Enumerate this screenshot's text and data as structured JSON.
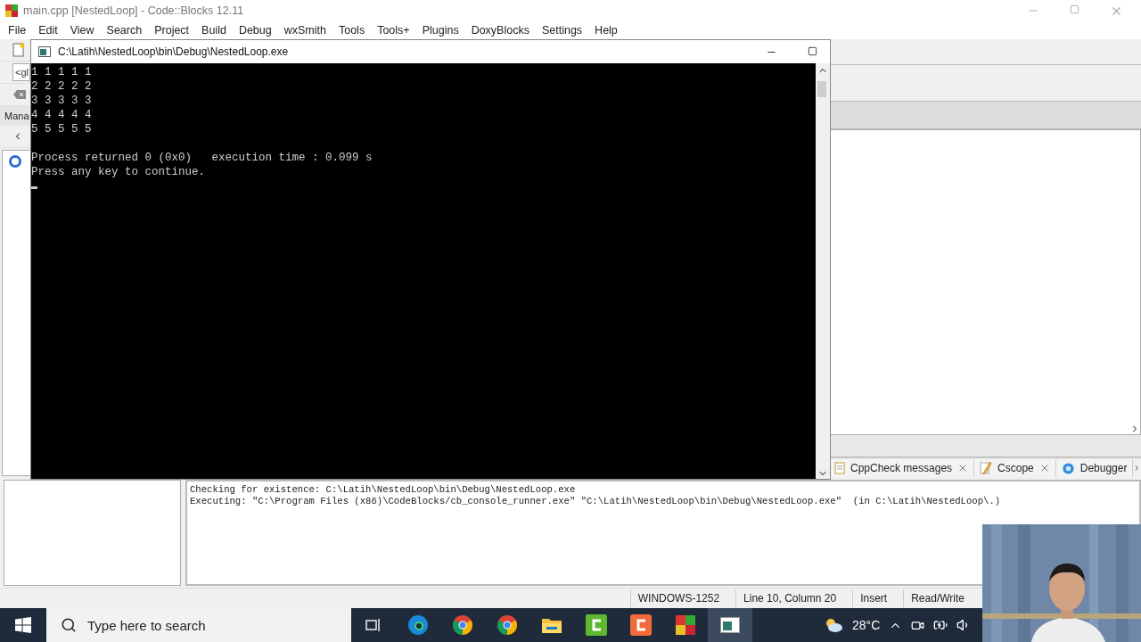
{
  "window": {
    "title": "main.cpp [NestedLoop] - Code::Blocks 12.11"
  },
  "menu": [
    "File",
    "Edit",
    "View",
    "Search",
    "Project",
    "Build",
    "Debug",
    "wxSmith",
    "Tools",
    "Tools+",
    "Plugins",
    "DoxyBlocks",
    "Settings",
    "Help"
  ],
  "left_dock": {
    "scope_field": "<gl",
    "tab": "Mana"
  },
  "console": {
    "title": "C:\\Latih\\NestedLoop\\bin\\Debug\\NestedLoop.exe",
    "output": [
      "1 1 1 1 1",
      "2 2 2 2 2",
      "3 3 3 3 3",
      "4 4 4 4 4",
      "5 5 5 5 5"
    ],
    "messages": [
      "Process returned 0 (0x0)   execution time : 0.099 s",
      "Press any key to continue."
    ]
  },
  "log_tabs": [
    {
      "label": "CppCheck messages",
      "kind": "notes"
    },
    {
      "label": "Cscope",
      "kind": "pencil"
    },
    {
      "label": "Debugger",
      "kind": "gear"
    }
  ],
  "log": [
    "Checking for existence: C:\\Latih\\NestedLoop\\bin\\Debug\\NestedLoop.exe",
    "Executing: \"C:\\Program Files (x86)\\CodeBlocks/cb_console_runner.exe\" \"C:\\Latih\\NestedLoop\\bin\\Debug\\NestedLoop.exe\"  (in C:\\Latih\\NestedLoop\\.)"
  ],
  "status_bar": [
    "WINDOWS-1252",
    "Line 10, Column 20",
    "Insert",
    "Read/Write"
  ],
  "taskbar": {
    "search": {
      "placeholder": "Type here to search"
    },
    "temperature": "28°C"
  },
  "webcam": {
    "kind": "picture"
  }
}
